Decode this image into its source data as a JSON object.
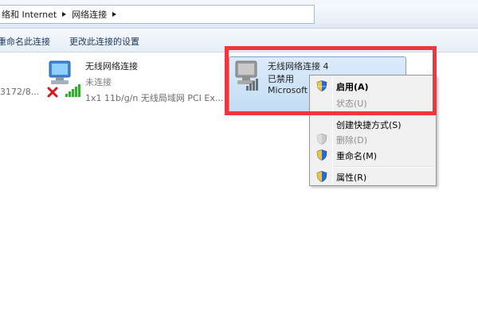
{
  "breadcrumb": {
    "item1": "络和 Internet",
    "item2": "网络连接"
  },
  "toolbar": {
    "rename_label": "重命名此连接",
    "change_settings_label": "更改此连接的设置"
  },
  "content": {
    "left_truncated_text": "3172/8...",
    "connections": [
      {
        "name": "无线网络连接",
        "status": "未连接",
        "adapter": "1x1 11b/g/n 无线局域网 PCI Ex..."
      },
      {
        "name": "无线网络连接 4",
        "status": "已禁用",
        "adapter": "Microsoft"
      }
    ]
  },
  "context_menu": {
    "items": [
      {
        "label": "启用(A)",
        "icon": "shield-icon",
        "enabled": true,
        "bold": true
      },
      {
        "label": "状态(U)",
        "icon": "",
        "enabled": false,
        "bold": false
      },
      {
        "label": "创建快捷方式(S)",
        "icon": "",
        "enabled": true,
        "bold": false
      },
      {
        "label": "删除(D)",
        "icon": "shield-icon",
        "enabled": false,
        "bold": false
      },
      {
        "label": "重命名(M)",
        "icon": "shield-icon",
        "enabled": true,
        "bold": false
      },
      {
        "label": "属性(R)",
        "icon": "shield-icon",
        "enabled": true,
        "bold": false
      }
    ]
  },
  "colors": {
    "highlight_border": "#f0353b",
    "selection_fill": "#c2dcf3",
    "menu_background": "#f0f0f0"
  }
}
